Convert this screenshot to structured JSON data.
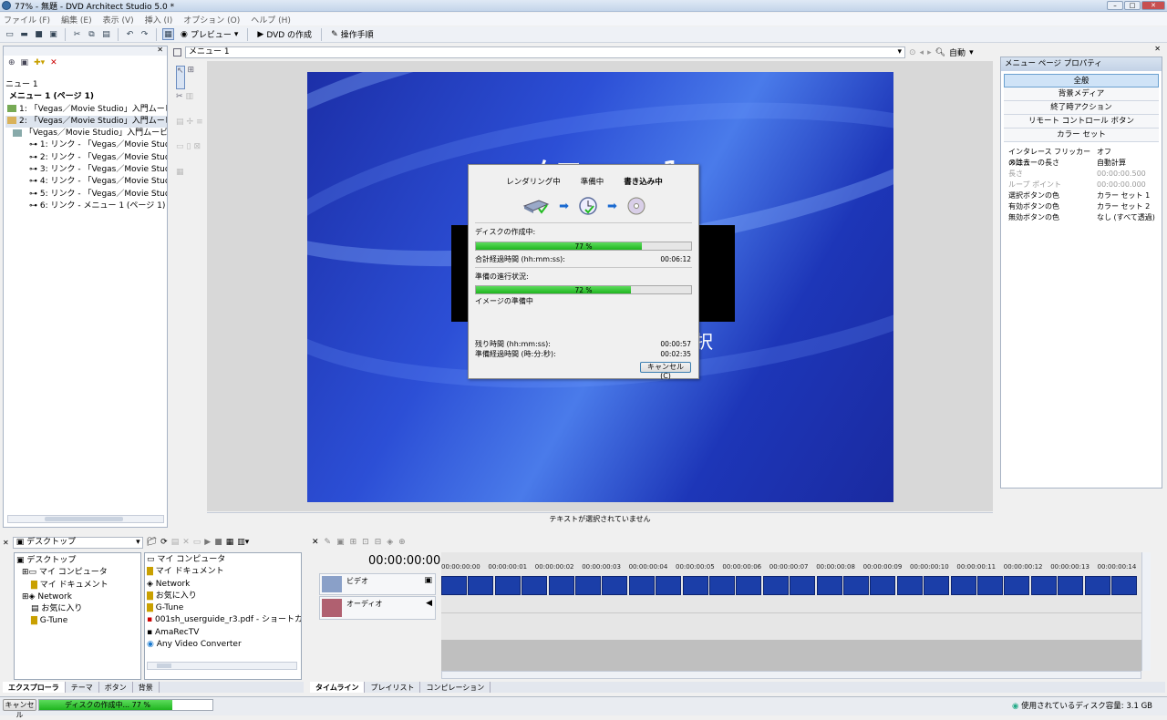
{
  "window": {
    "title": "77% - 無題 - DVD Architect Studio 5.0 *"
  },
  "menubar": [
    "ファイル (F)",
    "編集 (E)",
    "表示 (V)",
    "挿入 (I)",
    "オプション (O)",
    "ヘルプ (H)"
  ],
  "toolbar": {
    "preview": "プレビュー",
    "make_dvd": "DVD の作成",
    "guide": "操作手順"
  },
  "project_tree": {
    "items": [
      "ニュー 1",
      "メニュー 1 (ページ 1)",
      "1: 「Vegas／Movie Studio」入門ムービー",
      "2: 「Vegas／Movie Studio」入門ムービー",
      "「Vegas／Movie Studio」入門ムービー -",
      "1: リンク - 「Vegas／Movie Studio」",
      "2: リンク - 「Vegas／Movie Studio」",
      "3: リンク - 「Vegas／Movie Studio」",
      "4: リンク - 「Vegas／Movie Studio」",
      "5: リンク - 「Vegas／Movie Studio」",
      "6: リンク - メニュー 1 (ページ 1)"
    ]
  },
  "workspace": {
    "tab": "メニュー 1",
    "zoom": "自動",
    "status": "テキストが選択されていません"
  },
  "menu_preview": {
    "title": "メニュー 1",
    "subtext": "択"
  },
  "dialog": {
    "stages": [
      "レンダリング中",
      "準備中",
      "書き込み中"
    ],
    "disc_label": "ディスクの作成中:",
    "disc_progress": 77,
    "disc_progress_text": "77 %",
    "total_elapsed_label": "合計経過時間 (hh:mm:ss):",
    "total_elapsed": "00:06:12",
    "prep_label": "準備の進行状況:",
    "prep_progress": 72,
    "prep_progress_text": "72 %",
    "prep_status": "イメージの準備中",
    "remaining_label": "残り時間 (hh:mm:ss):",
    "remaining": "00:00:57",
    "prep_elapsed_label": "準備経過時間 (時:分:秒):",
    "prep_elapsed": "00:02:35",
    "cancel": "キャンセル (C)"
  },
  "properties": {
    "title": "メニュー ページ プロパティ",
    "buttons": [
      "全般",
      "背景メディア",
      "終了時アクション",
      "リモート コントロール ボタン",
      "カラー セット"
    ],
    "rows": [
      {
        "k": "インタレース フリッカーの除去",
        "v": "オフ",
        "dim": false
      },
      {
        "k": "メニューの長さ",
        "v": "自動計算",
        "dim": false
      },
      {
        "k": "長さ",
        "v": "00:00:00.500",
        "dim": true
      },
      {
        "k": "ループ ポイント",
        "v": "00:00:00.000",
        "dim": true
      },
      {
        "k": "選択ボタンの色",
        "v": "カラー セット 1",
        "dim": false
      },
      {
        "k": "有効ボタンの色",
        "v": "カラー セット 2",
        "dim": false
      },
      {
        "k": "無効ボタンの色",
        "v": "なし (すべて透過)",
        "dim": false
      }
    ]
  },
  "explorer": {
    "location": "デスクトップ",
    "tree": [
      "デスクトップ",
      "マイ コンピュータ",
      "マイ ドキュメント",
      "Network",
      "お気に入り",
      "G-Tune"
    ],
    "files": [
      "マイ コンピュータ",
      "マイ ドキュメント",
      "Network",
      "お気に入り",
      "G-Tune",
      "001sh_userguide_r3.pdf - ショートカット",
      "AmaRecTV",
      "Any Video Converter"
    ],
    "tabs": [
      "エクスプローラ",
      "テーマ",
      "ボタン",
      "背景"
    ]
  },
  "timeline": {
    "time": "00:00:00:00",
    "video_track": "ビデオ",
    "audio_track": "オーディオ",
    "ticks": [
      "00:00:00:00",
      "00:00:00:01",
      "00:00:00:02",
      "00:00:00:03",
      "00:00:00:04",
      "00:00:00:05",
      "00:00:00:06",
      "00:00:00:07",
      "00:00:00:08",
      "00:00:00:09",
      "00:00:00:10",
      "00:00:00:11",
      "00:00:00:12",
      "00:00:00:13",
      "00:00:00:14"
    ],
    "tabs": [
      "タイムライン",
      "プレイリスト",
      "コンピレーション"
    ]
  },
  "statusbar": {
    "cancel": "キャンセル",
    "progress_text": "ディスクの作成中... 77 %",
    "progress": 77,
    "disk_usage": "使用されているディスク容量: 3.1 GB"
  }
}
